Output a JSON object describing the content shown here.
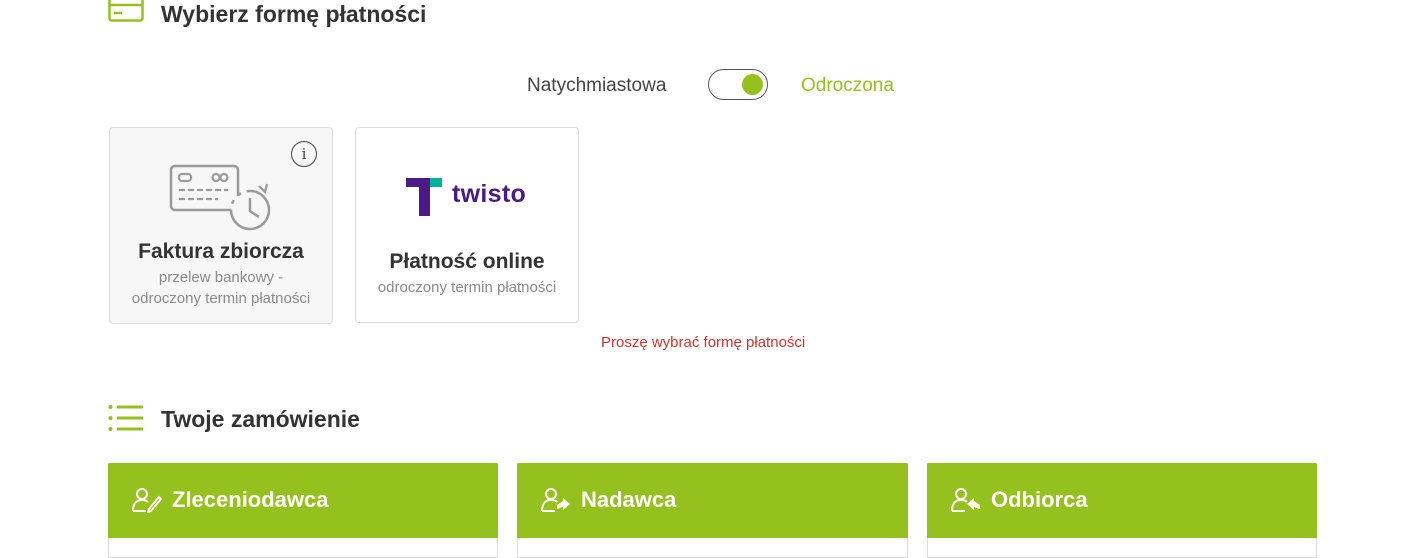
{
  "payment": {
    "title": "Wybierz formę płatności",
    "options": {
      "left": "Natychmiastowa",
      "right": "Odroczona",
      "selected": "Odroczona"
    },
    "cards": [
      {
        "title": "Faktura zbiorcza",
        "subtitle_line1": "przelew bankowy -",
        "subtitle_line2": "odroczony termin płatności",
        "info": "i"
      },
      {
        "brand": "twisto",
        "title": "Płatność online",
        "subtitle": "odroczony termin płatności"
      }
    ],
    "error": "Proszę wybrać formę płatności"
  },
  "order": {
    "title": "Twoje zamówienie",
    "panels": [
      {
        "label": "Zleceniodawca",
        "icon": "person-edit-icon"
      },
      {
        "label": "Nadawca",
        "icon": "person-send-icon"
      },
      {
        "label": "Odbiorca",
        "icon": "person-receive-icon"
      }
    ]
  },
  "colors": {
    "accent": "#95c11f",
    "error": "#d0312d",
    "brand_twisto": "#4b1a87"
  }
}
